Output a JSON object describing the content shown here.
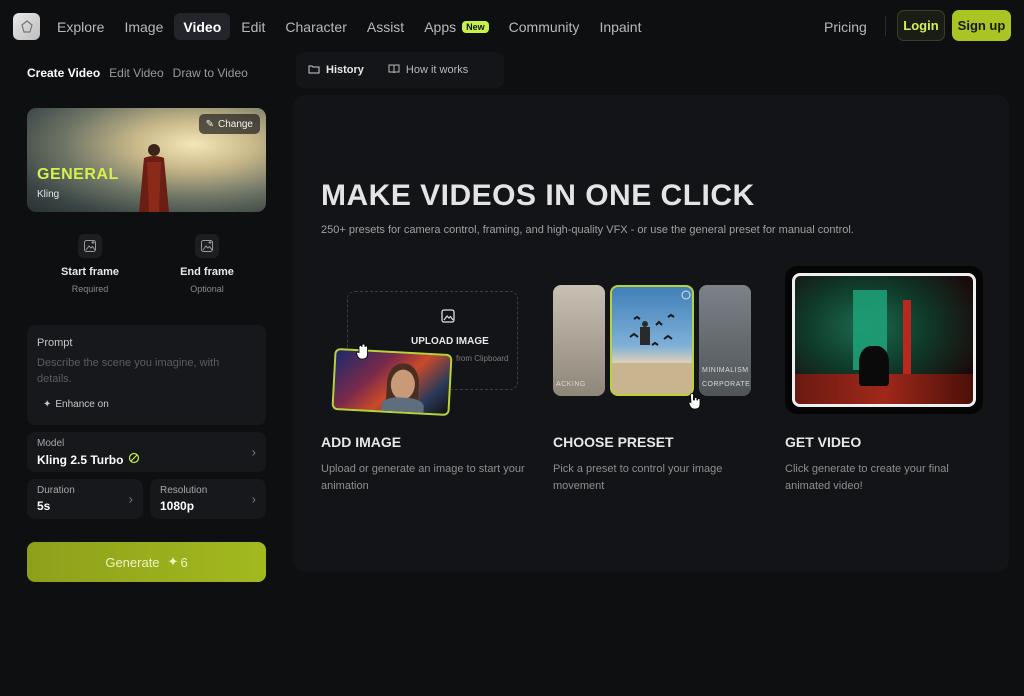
{
  "nav": {
    "items": [
      "Explore",
      "Image",
      "Video",
      "Edit",
      "Character",
      "Assist",
      "Apps",
      "Community",
      "Inpaint"
    ],
    "active": "Video",
    "new_badge": "New",
    "pricing": "Pricing",
    "login": "Login",
    "signup": "Sign up"
  },
  "subtabs": [
    "Create Video",
    "Edit Video",
    "Draw to Video"
  ],
  "preset": {
    "title": "GENERAL",
    "sub": "Kling",
    "change": "Change"
  },
  "frames": {
    "start": {
      "title": "Start frame",
      "sub": "Required"
    },
    "end": {
      "title": "End frame",
      "sub": "Optional"
    }
  },
  "prompt": {
    "label": "Prompt",
    "placeholder": "Describe the scene you imagine, with details.",
    "enhance": "Enhance on"
  },
  "model": {
    "label": "Model",
    "value": "Kling 2.5 Turbo"
  },
  "duration": {
    "label": "Duration",
    "value": "5s"
  },
  "resolution": {
    "label": "Resolution",
    "value": "1080p"
  },
  "generate": {
    "label": "Generate",
    "cost": "6"
  },
  "tabs": {
    "history": "History",
    "how": "How it works"
  },
  "main": {
    "headline": "MAKE VIDEOS IN ONE CLICK",
    "subline": "250+ presets for camera control, framing, and high-quality VFX - or use the general preset for manual control."
  },
  "upload": {
    "title": "UPLOAD IMAGE",
    "sub": "from Clipboard"
  },
  "preset_strip": {
    "left": "ACKING",
    "right1": "MINIMALISM",
    "right2": "CORPORATE"
  },
  "steps": [
    {
      "title": "ADD IMAGE",
      "text": "Upload or generate an image to start your animation"
    },
    {
      "title": "CHOOSE PRESET",
      "text": "Pick a preset to control your image movement"
    },
    {
      "title": "GET VIDEO",
      "text": "Click generate to create your final animated video!"
    }
  ],
  "colors": {
    "accent": "#a9c423",
    "accent_text": "#d5f24a",
    "bg": "#0e0f11",
    "panel": "#131417"
  }
}
